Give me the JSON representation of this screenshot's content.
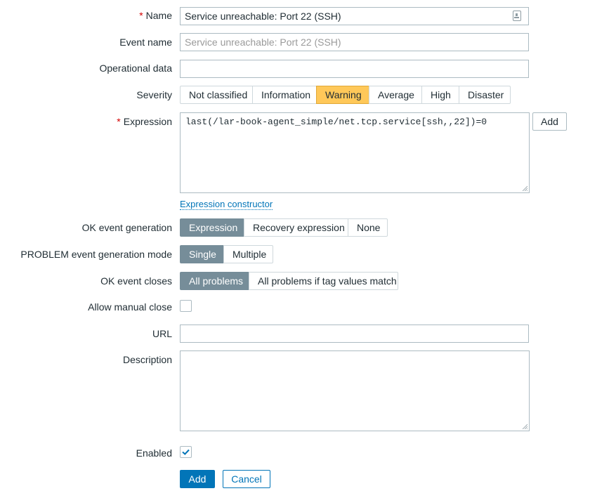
{
  "form": {
    "name": {
      "label": "Name",
      "required": true,
      "value": "Service unreachable: Port 22 (SSH)",
      "icon": "macro-insert-icon"
    },
    "event_name": {
      "label": "Event name",
      "placeholder": "Service unreachable: Port 22 (SSH)",
      "value": ""
    },
    "operational_data": {
      "label": "Operational data",
      "value": ""
    },
    "severity": {
      "label": "Severity",
      "options": [
        "Not classified",
        "Information",
        "Warning",
        "Average",
        "High",
        "Disaster"
      ],
      "selected": "Warning",
      "selected_color": "#ffc859"
    },
    "expression": {
      "label": "Expression",
      "required": true,
      "value": "last(/lar-book-agent_simple/net.tcp.service[ssh,,22])=0",
      "add_label": "Add",
      "constructor_link": "Expression constructor"
    },
    "ok_event_generation": {
      "label": "OK event generation",
      "options": [
        "Expression",
        "Recovery expression",
        "None"
      ],
      "selected": "Expression"
    },
    "problem_event_generation_mode": {
      "label": "PROBLEM event generation mode",
      "options": [
        "Single",
        "Multiple"
      ],
      "selected": "Single"
    },
    "ok_event_closes": {
      "label": "OK event closes",
      "options": [
        "All problems",
        "All problems if tag values match"
      ],
      "selected": "All problems"
    },
    "allow_manual_close": {
      "label": "Allow manual close",
      "checked": false
    },
    "url": {
      "label": "URL",
      "value": ""
    },
    "description": {
      "label": "Description",
      "value": ""
    },
    "enabled": {
      "label": "Enabled",
      "checked": true
    }
  },
  "actions": {
    "add_label": "Add",
    "cancel_label": "Cancel"
  },
  "colors": {
    "primary": "#0275b8",
    "selected_segment": "#768d99",
    "required_marker": "#d40000"
  }
}
